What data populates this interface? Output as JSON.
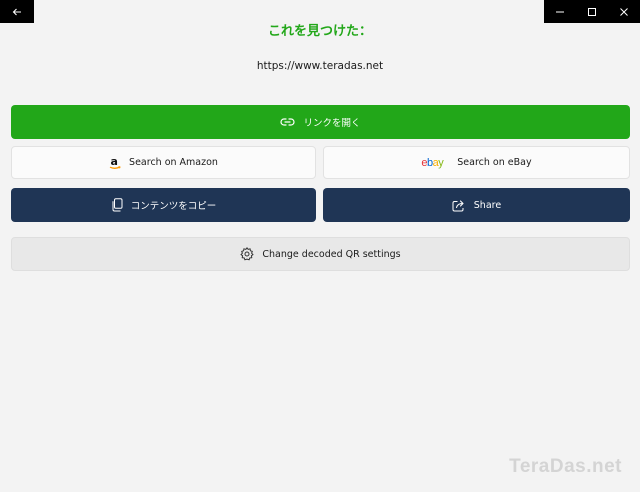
{
  "window": {
    "back_icon": "arrow-left-icon",
    "controls": [
      "minimize-icon",
      "maximize-icon",
      "close-icon"
    ]
  },
  "result": {
    "title": "これを見つけた：",
    "content": "https://www.teradas.net"
  },
  "actions": {
    "open_link": "リンクを開く",
    "search_amazon": "Search on Amazon",
    "search_ebay": "Search on eBay",
    "ebay_logo": [
      "e",
      "b",
      "a",
      "y"
    ],
    "copy_content": "コンテンツをコピー",
    "share": "Share",
    "change_settings": "Change decoded QR settings"
  },
  "watermark": "TeraDas.net",
  "colors": {
    "accent_green": "#22a719",
    "navy": "#1f3555",
    "ebay": [
      "#e53238",
      "#0064d2",
      "#f5af02",
      "#86b817"
    ]
  }
}
